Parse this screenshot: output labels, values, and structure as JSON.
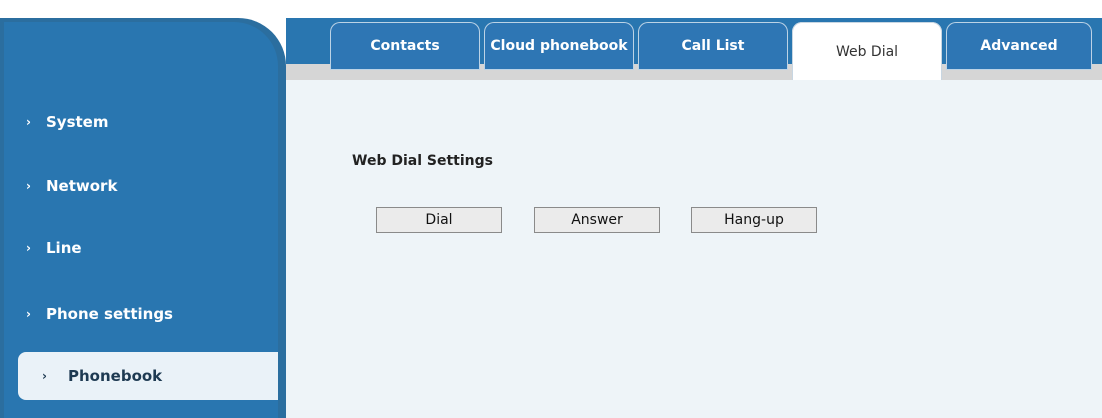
{
  "sidebar": {
    "items": [
      {
        "label": "System"
      },
      {
        "label": "Network"
      },
      {
        "label": "Line"
      },
      {
        "label": "Phone settings"
      },
      {
        "label": "Phonebook",
        "active": true
      }
    ],
    "chevron_icon": "chevron-right-icon"
  },
  "tabs": [
    {
      "label": "Contacts"
    },
    {
      "label": "Cloud phonebook"
    },
    {
      "label": "Call List"
    },
    {
      "label": "Web Dial",
      "active": true
    },
    {
      "label": "Advanced"
    }
  ],
  "main": {
    "section_title": "Web Dial Settings",
    "buttons": {
      "dial": "Dial",
      "answer": "Answer",
      "hangup": "Hang-up"
    }
  },
  "colors": {
    "sidebar_bg": "#2976b0",
    "content_bg": "#eef4f8",
    "tab_bg": "#2e76b4",
    "active_tab_bg": "#ffffff"
  }
}
